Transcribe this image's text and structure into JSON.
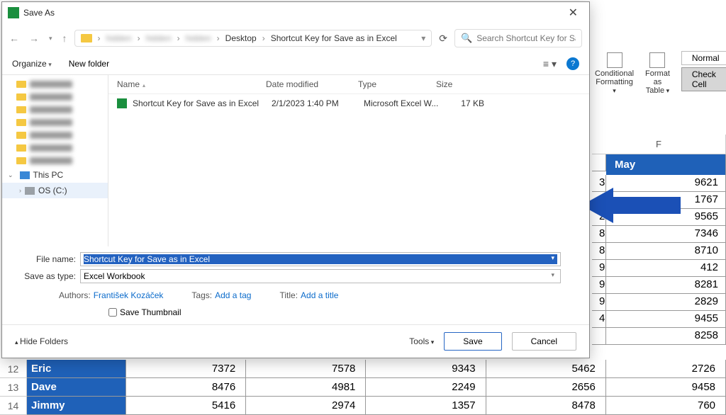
{
  "dialog": {
    "title": "Save As",
    "breadcrumbs": {
      "b1": "Desktop",
      "b2": "Shortcut Key for Save as in Excel"
    },
    "search_placeholder": "Search Shortcut Key for Save...",
    "organize": "Organize",
    "new_folder": "New folder",
    "tree": {
      "this_pc": "This PC",
      "os": "OS (C:)"
    },
    "cols": {
      "name": "Name",
      "date": "Date modified",
      "type": "Type",
      "size": "Size"
    },
    "file": {
      "name": "Shortcut Key for Save as in Excel",
      "date": "2/1/2023 1:40 PM",
      "type": "Microsoft Excel W...",
      "size": "17 KB"
    },
    "file_name_label": "File name:",
    "file_name_value": "Shortcut Key for Save as in Excel",
    "save_type_label": "Save as type:",
    "save_type_value": "Excel Workbook",
    "authors_label": "Authors:",
    "authors_value": "František Kozáček",
    "tags_label": "Tags:",
    "tags_value": "Add a tag",
    "title_label": "Title:",
    "title_value": "Add a title",
    "save_thumb": "Save Thumbnail",
    "hide_folders": "Hide Folders",
    "tools": "Tools",
    "save": "Save",
    "cancel": "Cancel"
  },
  "ribbon": {
    "cond_fmt": "Conditional\nFormatting",
    "fmt_table": "Format as\nTable",
    "normal": "Normal",
    "check_cell": "Check Cell"
  },
  "sheet": {
    "col_letter": "F",
    "month": "May",
    "partial": [
      "3",
      "",
      "2",
      "8",
      "8",
      "9",
      "9",
      "9",
      "4"
    ],
    "vals": [
      "9621",
      "1767",
      "9565",
      "7346",
      "8710",
      "412",
      "8281",
      "2829",
      "9455",
      "8258",
      "2726",
      "9458",
      "760"
    ]
  },
  "rows": [
    {
      "n": "12",
      "name": "Eric",
      "v": [
        "7372",
        "7578",
        "9343",
        "5462",
        "2726"
      ]
    },
    {
      "n": "13",
      "name": "Dave",
      "v": [
        "8476",
        "4981",
        "2249",
        "2656",
        "9458"
      ]
    },
    {
      "n": "14",
      "name": "Jimmy",
      "v": [
        "5416",
        "2974",
        "1357",
        "8478",
        "760"
      ]
    }
  ]
}
